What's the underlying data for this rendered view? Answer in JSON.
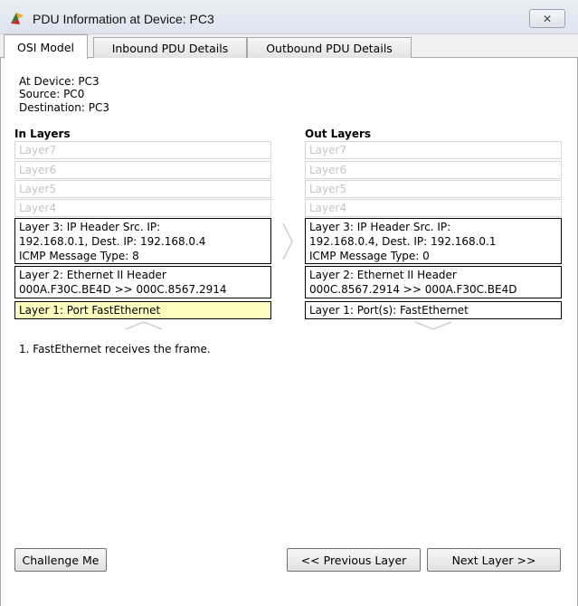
{
  "window": {
    "title": "PDU Information at Device: PC3",
    "close_symbol": "✕"
  },
  "tabs": [
    {
      "label": "OSI Model",
      "active": true
    },
    {
      "label": "Inbound PDU Details",
      "active": false
    },
    {
      "label": "Outbound PDU Details",
      "active": false
    }
  ],
  "info": {
    "at_device": "At Device: PC3",
    "source": "Source: PC0",
    "destination": "Destination: PC3"
  },
  "in_layers": {
    "header": "In Layers",
    "layers": [
      "Layer7",
      "Layer6",
      "Layer5",
      "Layer4",
      "Layer 3: IP Header Src. IP:\n192.168.0.1, Dest. IP: 192.168.0.4\nICMP Message Type: 8",
      "Layer 2: Ethernet II Header\n000A.F30C.BE4D >> 000C.8567.2914",
      "Layer 1: Port FastEthernet"
    ]
  },
  "out_layers": {
    "header": "Out Layers",
    "layers": [
      "Layer7",
      "Layer6",
      "Layer5",
      "Layer4",
      "Layer 3: IP Header Src. IP:\n192.168.0.4, Dest. IP: 192.168.0.1\nICMP Message Type: 0",
      "Layer 2: Ethernet II Header\n000C.8567.2914 >> 000A.F30C.BE4D",
      "Layer 1: Port(s): FastEthernet"
    ]
  },
  "description": "1. FastEthernet receives the frame.",
  "buttons": {
    "challenge": "Challenge Me",
    "previous": "<< Previous Layer",
    "next": "Next Layer >>"
  },
  "icons": {
    "app": "packet-tracer-icon",
    "close": "close-icon",
    "arrow_right": "chevron-right-icon",
    "arrow_down": "chevron-down-icon"
  }
}
